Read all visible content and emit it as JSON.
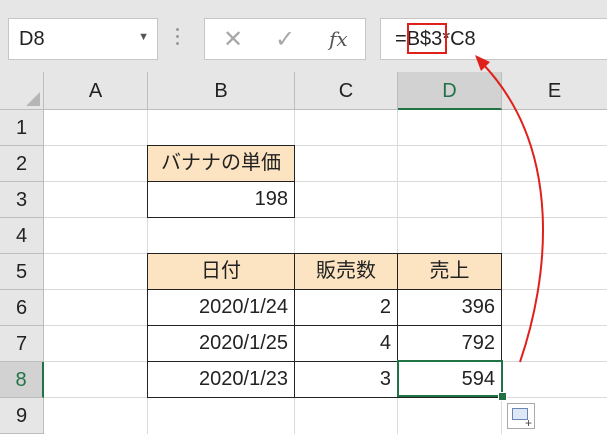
{
  "formula_bar": {
    "name_box": "D8",
    "name_box_dropdown_icon": "chevron-down-icon",
    "cancel_icon": "✕",
    "enter_icon": "✓",
    "fx_label": "fx",
    "formula_prefix": "=",
    "formula_highlight": "B$3",
    "formula_suffix": "*C8"
  },
  "columns": [
    "A",
    "B",
    "C",
    "D",
    "E"
  ],
  "selected_column": "D",
  "rows": [
    "1",
    "2",
    "3",
    "4",
    "5",
    "6",
    "7",
    "8",
    "9"
  ],
  "selected_row": "8",
  "price_table": {
    "header": "バナナの単価",
    "value": "198"
  },
  "sales_table": {
    "headers": [
      "日付",
      "販売数",
      "売上"
    ],
    "rows": [
      {
        "date": "2020/1/24",
        "qty": "2",
        "sales": "396"
      },
      {
        "date": "2020/1/25",
        "qty": "4",
        "sales": "792"
      },
      {
        "date": "2020/1/23",
        "qty": "3",
        "sales": "594"
      }
    ]
  },
  "colors": {
    "header_fill": "#fce4c2",
    "selection": "#217346",
    "highlight": "#e0201b"
  }
}
